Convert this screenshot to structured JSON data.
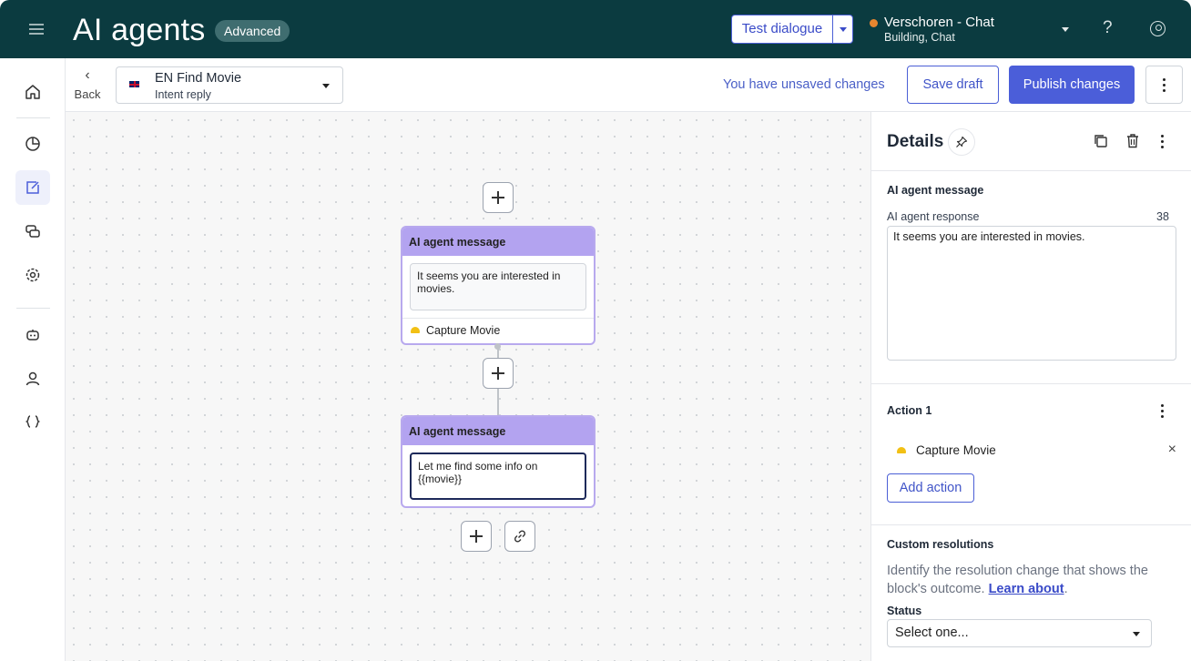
{
  "header": {
    "title": "AI agents",
    "badge": "Advanced",
    "test_button": "Test dialogue",
    "workspace_name": "Verschoren - Chat",
    "workspace_sub": "Building, Chat",
    "help": "?"
  },
  "subheader": {
    "back": "Back",
    "intent_name": "EN Find Movie",
    "intent_type": "Intent reply",
    "unsaved": "You have unsaved changes",
    "save_draft": "Save draft",
    "publish": "Publish changes"
  },
  "canvas": {
    "nodes": [
      {
        "title": "AI agent message",
        "message": "It seems you are interested in movies.",
        "action": "Capture Movie"
      },
      {
        "title": "AI agent message",
        "message": "Let me find some info on {{movie}}"
      }
    ]
  },
  "details": {
    "title": "Details",
    "section_message": "AI agent message",
    "response_label": "AI agent response",
    "response_count": "38",
    "response_value": "It seems you are interested in movies.",
    "action_title": "Action 1",
    "action_item": "Capture Movie",
    "add_action": "Add action",
    "custom_title": "Custom resolutions",
    "custom_desc": "Identify the resolution change that shows the block's outcome.",
    "learn_about": "Learn about",
    "desc_end": ".",
    "status_label": "Status",
    "status_value": "Select one..."
  },
  "colors": {
    "header_bg": "#0b3b40",
    "accent": "#4b5ed9",
    "node_header": "#b3a3f0",
    "status_dot": "#e8862f"
  }
}
